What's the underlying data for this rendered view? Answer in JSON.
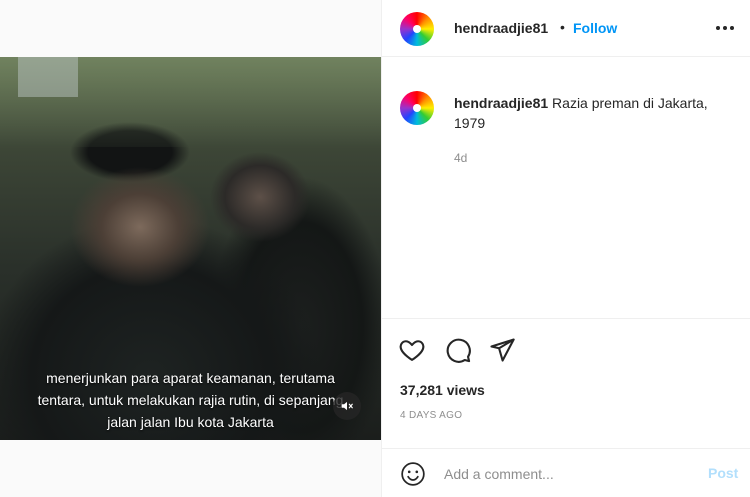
{
  "post": {
    "username": "hendraadjie81",
    "separator": "•",
    "follow_label": "Follow",
    "more_icon": "more-horizontal-icon",
    "caption_text": "Razia preman di Jakarta, 1979",
    "caption_time": "4d"
  },
  "video": {
    "subtitle_line1": "menerjunkan para aparat keamanan, terutama",
    "subtitle_line2": "tentara, untuk melakukan rajia rutin, di sepanjang",
    "subtitle_line3": "jalan jalan Ibu kota Jakarta",
    "mute_icon": "speaker-muted-icon"
  },
  "actions": {
    "like_icon": "heart-icon",
    "comment_icon": "comment-bubble-icon",
    "share_icon": "paper-plane-icon"
  },
  "stats": {
    "views": "37,281 views",
    "posted_ago": "4 DAYS AGO"
  },
  "comment_box": {
    "placeholder": "Add a comment...",
    "post_label": "Post",
    "emoji_icon": "smiley-icon"
  },
  "colors": {
    "accent": "#0095f6",
    "post_disabled": "#b2dffc",
    "muted_text": "#8e8e8e"
  }
}
